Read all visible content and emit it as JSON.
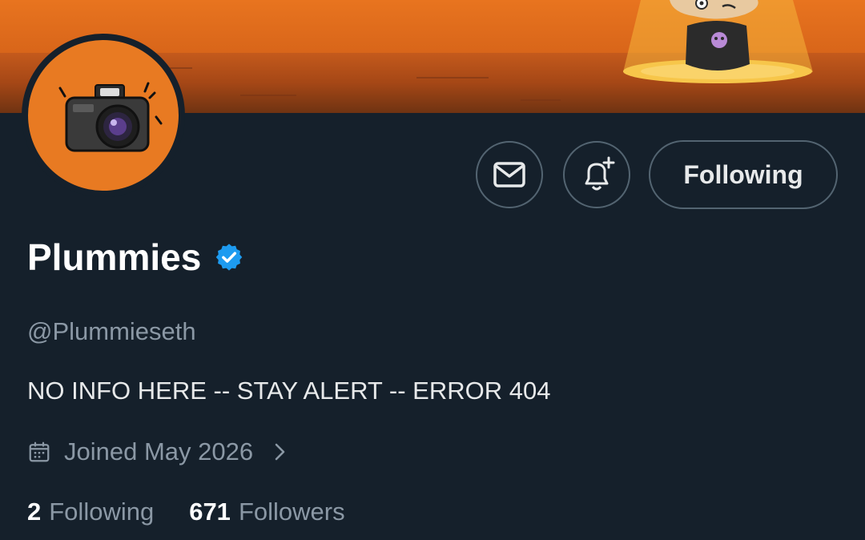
{
  "banner": {
    "image_name": "orange-desert-spotlight-character",
    "primary_color": "#e8741f"
  },
  "avatar": {
    "image_name": "cartoon-camera-avatar",
    "background_color": "#e87a22"
  },
  "actions": {
    "message_icon": "envelope-icon",
    "notify_icon": "bell-plus-icon",
    "follow_label": "Following"
  },
  "profile": {
    "name": "Plummies",
    "verified_icon": "verified-badge-icon",
    "verified_color": "#1d9bf0",
    "handle": "@Plummieseth",
    "bio": "NO INFO HERE -- STAY ALERT -- ERROR 404",
    "joined_icon": "calendar-icon",
    "joined": "Joined May 2026",
    "joined_chevron_icon": "chevron-right-icon"
  },
  "stats": {
    "following_count": "2",
    "following_label": "Following",
    "followers_count": "671",
    "followers_label": "Followers"
  }
}
